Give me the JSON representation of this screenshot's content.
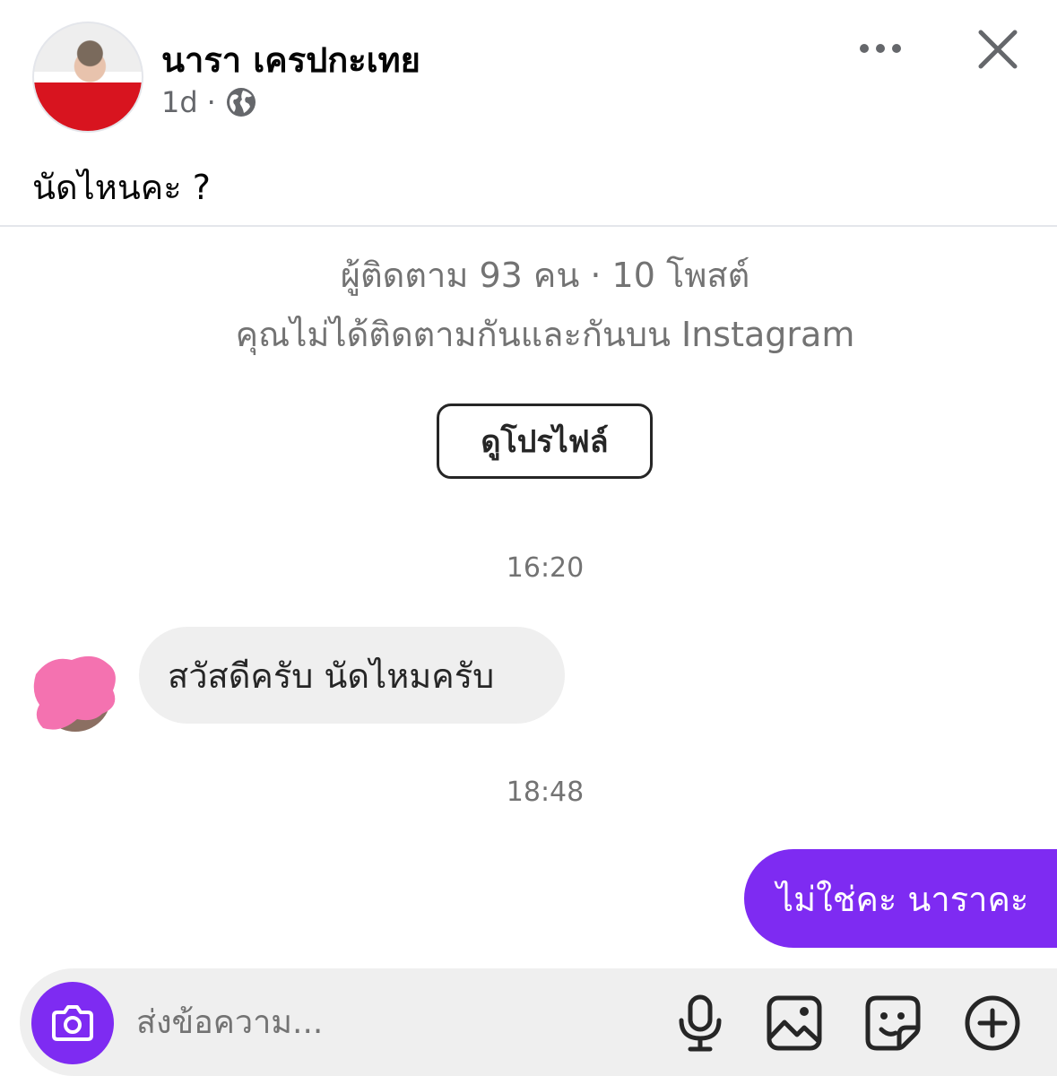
{
  "post": {
    "author_name": "นารา เครปกะเทย",
    "time": "1d",
    "separator": "·",
    "audience_icon": "globe-icon",
    "caption": "นัดไหนคะ ?"
  },
  "chat": {
    "profile_stats": "ผู้ติดตาม 93 คน · 10 โพสต์",
    "follow_note": "คุณไม่ได้ติดตามกันและกันบน Instagram",
    "view_profile_label": "ดูโปรไฟล์",
    "messages": [
      {
        "timestamp": "16:20",
        "direction": "incoming",
        "text": "สวัสดีครับ นัดไหมครับ"
      },
      {
        "timestamp": "18:48",
        "direction": "outgoing",
        "text": "ไม่ใช่คะ นาราคะ"
      }
    ]
  },
  "composer": {
    "placeholder": "ส่งข้อความ...",
    "icons": [
      "camera-icon",
      "microphone-icon",
      "gallery-icon",
      "sticker-icon",
      "plus-icon"
    ]
  },
  "colors": {
    "accent_purple": "#7e2bf2",
    "incoming_bubble": "#efefef",
    "secondary_text": "#737373",
    "sender_avatar_overlay": "#f472b0"
  }
}
